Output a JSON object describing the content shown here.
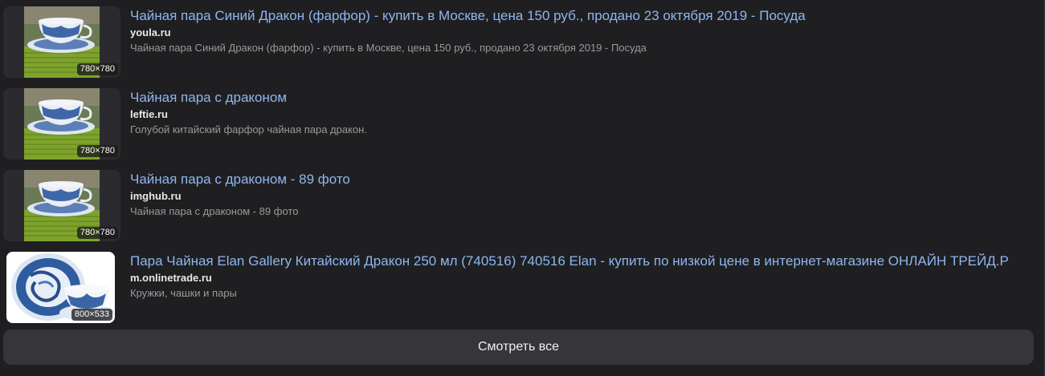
{
  "results": [
    {
      "title": "Чайная пара Синий Дракон (фарфор) - купить в Москве, цена 150 руб., продано 23 октября 2019 - Посуда",
      "domain": "youla.ru",
      "snippet": "Чайная пара Синий Дракон (фарфор) - купить в Москве, цена 150 руб., продано 23 октября 2019 - Посуда",
      "image_size": "780×780",
      "thumb_icon": "blue-dragon-teacup-image"
    },
    {
      "title": "Чайная пара с драконом",
      "domain": "leftie.ru",
      "snippet": "Голубой китайский фарфор чайная пара дракон.",
      "image_size": "780×780",
      "thumb_icon": "blue-dragon-teacup-image"
    },
    {
      "title": "Чайная пара с драконом - 89 фото",
      "domain": "imghub.ru",
      "snippet": "Чайная пара с драконом - 89 фото",
      "image_size": "780×780",
      "thumb_icon": "blue-dragon-teacup-image"
    },
    {
      "title": "Пара Чайная Elan Gallery Китайский Дракон 250 мл (740516) 740516 Elan - купить по низкой цене в интернет-магазине ОНЛАЙН ТРЕЙД.Р",
      "domain": "m.onlinetrade.ru",
      "snippet": "Кружки, чашки и пары",
      "image_size": "800×533",
      "thumb_icon": "dragon-tea-set-image"
    }
  ],
  "see_all_label": "Смотреть все",
  "colors": {
    "background": "#1f1f22",
    "title_link": "#8fb6ee",
    "domain": "#e8e8e8",
    "snippet": "#9a9a9a",
    "button_bg": "#36363a"
  }
}
